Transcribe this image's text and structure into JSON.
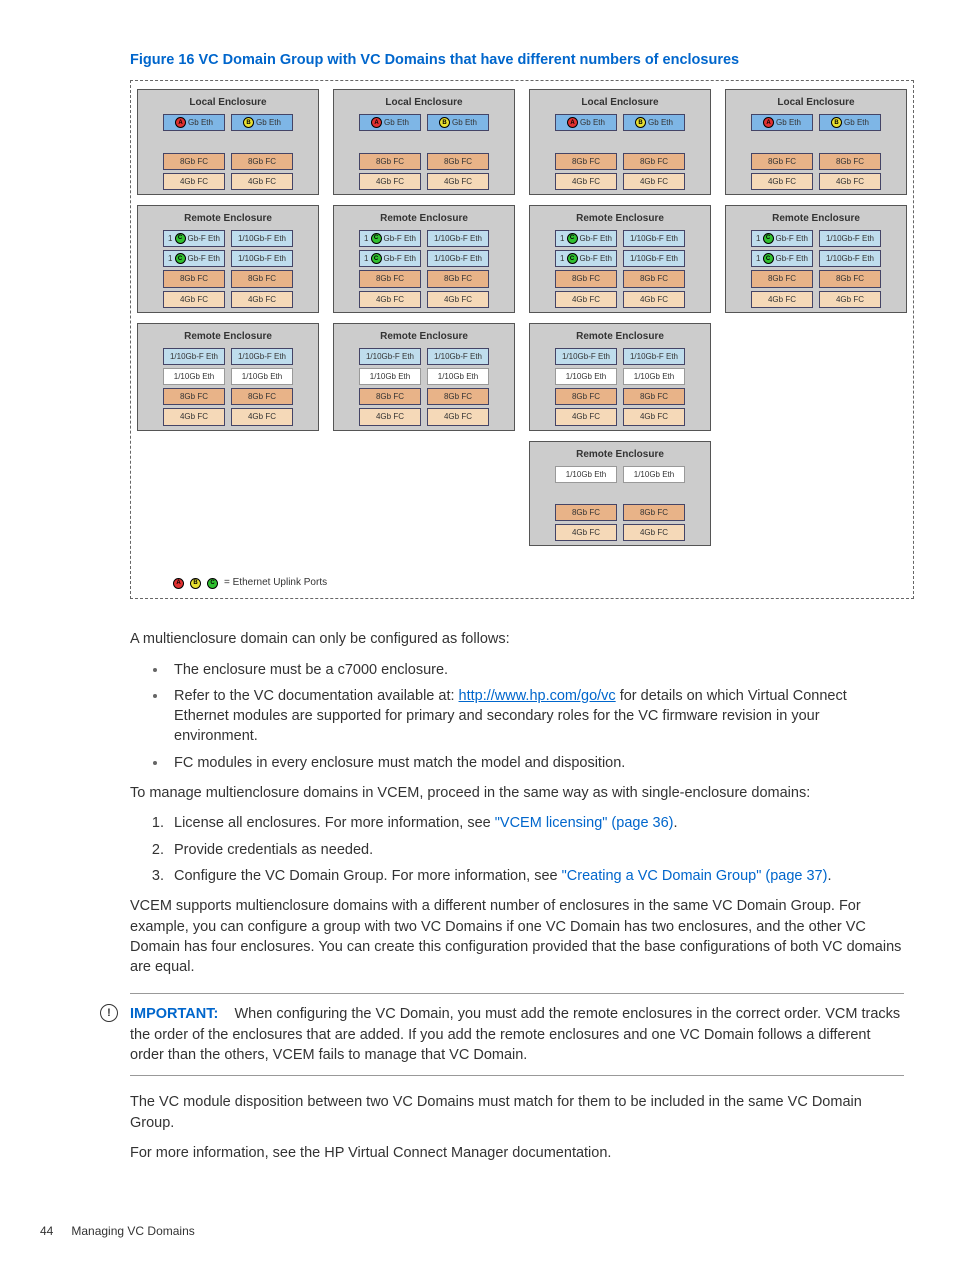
{
  "figure_title": "Figure 16 VC Domain Group with VC Domains that have different numbers of enclosures",
  "labels": {
    "local": "Local Enclosure",
    "remote": "Remote Enclosure",
    "gb_eth": "Gb Eth",
    "one_gb_f_eth": "1/10Gb-F Eth",
    "one_gb_eth": "1/10Gb Eth",
    "eight_fc": "8Gb FC",
    "four_fc": "4Gb FC",
    "gb_f_eth": "Gb-F Eth"
  },
  "legend": "= Ethernet Uplink Ports",
  "legend_letters": [
    "A",
    "B",
    "C"
  ],
  "body": {
    "p1": "A multienclosure domain can only be configured as follows:",
    "b1": "The enclosure must be a c7000 enclosure.",
    "b2a": "Refer to the VC documentation available at: ",
    "b2_link": "http://www.hp.com/go/vc",
    "b2b": " for details on which Virtual Connect Ethernet modules are supported for primary and secondary roles for the VC firmware revision in your environment.",
    "b3": "FC modules in every enclosure must match the model and disposition.",
    "p2": "To manage multienclosure domains in VCEM, proceed in the same way as with single-enclosure domains:",
    "o1a": "License all enclosures. For more information, see ",
    "o1_link": "\"VCEM licensing\" (page 36)",
    "o1b": ".",
    "o2": "Provide credentials as needed.",
    "o3a": "Configure the VC Domain Group. For more information, see ",
    "o3_link": "\"Creating a VC Domain Group\" (page 37)",
    "o3b": ".",
    "p3": "VCEM supports multienclosure domains with a different number of enclosures in the same VC Domain Group. For example, you can configure a group with two VC Domains if one VC Domain has two enclosures, and the other VC Domain has four enclosures. You can create this configuration provided that the base configurations of both VC domains are equal.",
    "important_label": "IMPORTANT:",
    "important_text": "When configuring the VC Domain, you must add the remote enclosures in the correct order. VCM tracks the order of the enclosures that are added. If you add the remote enclosures and one VC Domain follows a different order than the others, VCEM fails to manage that VC Domain.",
    "p4": "The VC module disposition between two VC Domains must match for them to be included in the same VC Domain Group.",
    "p5": "For more information, see the HP Virtual Connect Manager documentation."
  },
  "footer": {
    "page": "44",
    "section": "Managing VC Domains"
  },
  "diagram_columns": [
    3,
    3,
    4,
    2
  ],
  "chart_data": {
    "type": "diagram",
    "description": "Four VC Domain columns, each starting with a Local Enclosure followed by Remote Enclosures. Counts of enclosures per column: [3,3,4,2]. Each Local Enclosure has two Gb Eth modules (ports A,B), then 8Gb FC x2, 4Gb FC x2. First Remote Enclosure in each column has two rows of 1/10Gb-F Eth (first module of each row has port C), then 8Gb FC x2, 4Gb FC x2. Additional remotes have 1/10Gb-F Eth x2, 1/10Gb Eth x2, 8Gb FC x2, 4Gb FC x2. Column 3 has an extra remote with 1/10Gb Eth x2, blank row, 8Gb FC x2, 4Gb FC x2."
  }
}
